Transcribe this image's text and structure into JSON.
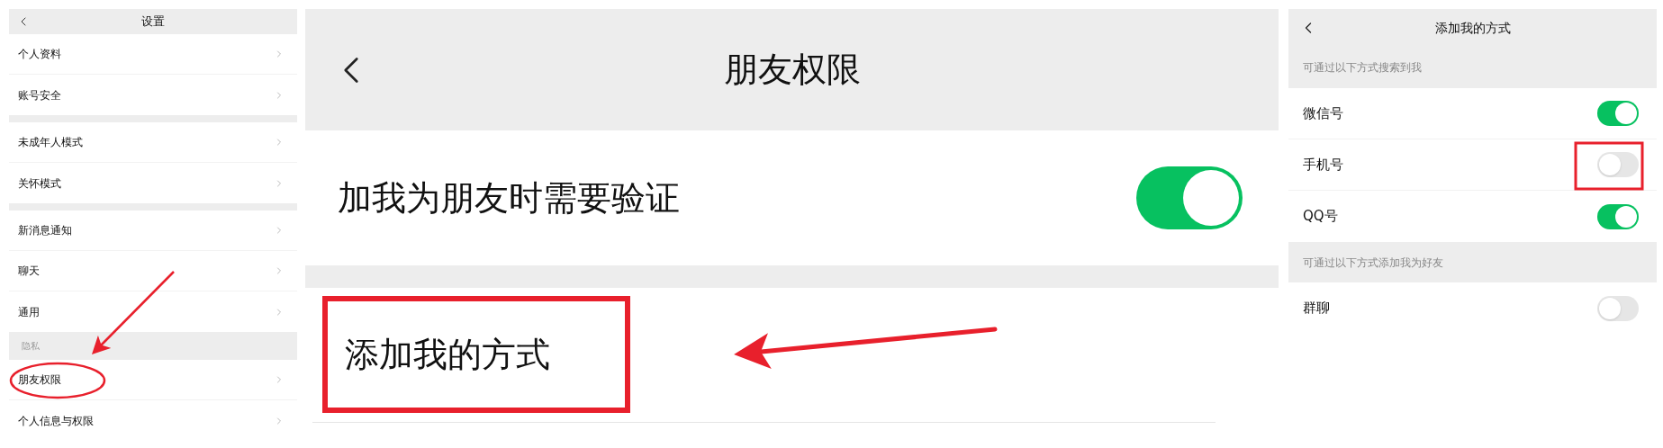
{
  "settings": {
    "title": "设置",
    "groups": [
      {
        "items": [
          {
            "label": "个人资料"
          },
          {
            "label": "账号安全"
          }
        ]
      },
      {
        "items": [
          {
            "label": "未成年人模式"
          },
          {
            "label": "关怀模式"
          }
        ]
      },
      {
        "items": [
          {
            "label": "新消息通知"
          },
          {
            "label": "聊天"
          },
          {
            "label": "通用"
          }
        ]
      },
      {
        "header": "隐私",
        "items": [
          {
            "label": "朋友权限"
          },
          {
            "label": "个人信息与权限"
          }
        ]
      }
    ]
  },
  "friend_permissions": {
    "title": "朋友权限",
    "groups": [
      {
        "items": [
          {
            "kind": "toggle",
            "label": "加我为朋友时需要验证",
            "on": true
          }
        ]
      },
      {
        "items": [
          {
            "kind": "link",
            "label": "添加我的方式"
          }
        ]
      }
    ]
  },
  "add_methods": {
    "title": "添加我的方式",
    "groups": [
      {
        "header": "可通过以下方式搜索到我",
        "items": [
          {
            "label": "微信号",
            "on": true
          },
          {
            "label": "手机号",
            "on": false
          },
          {
            "label": "QQ号",
            "on": true
          }
        ]
      },
      {
        "header": "可通过以下方式添加我为好友",
        "items": [
          {
            "label": "群聊",
            "on": false
          }
        ]
      }
    ]
  }
}
